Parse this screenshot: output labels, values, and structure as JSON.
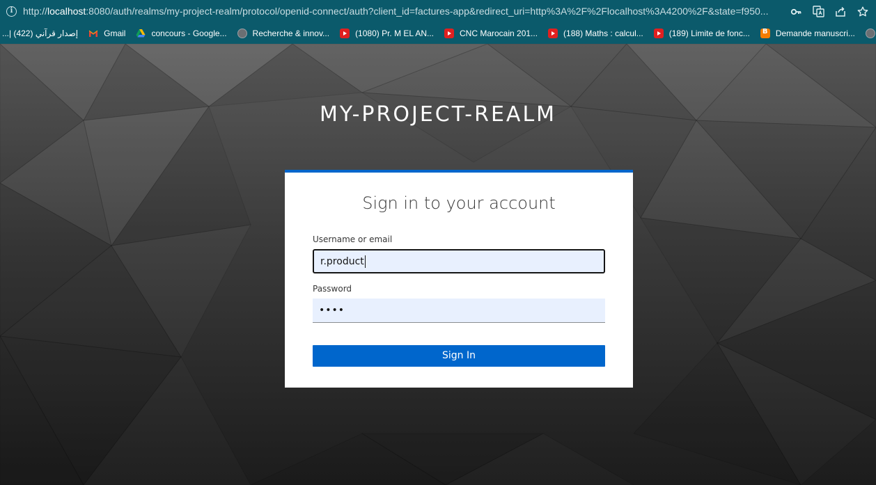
{
  "browser": {
    "url_prefix": "http://",
    "url_host": "localhost",
    "url_rest": ":8080/auth/realms/my-project-realm/protocol/openid-connect/auth?client_id=factures-app&redirect_uri=http%3A%2F%2Flocalhost%3A4200%2F&state=f950...",
    "info_icon_glyph": "i",
    "actions": [
      "key-icon",
      "translate-icon",
      "share-icon",
      "star-icon"
    ]
  },
  "bookmarks": [
    {
      "label": "إصدار قرآني (422) |...",
      "icon": "none"
    },
    {
      "label": "Gmail",
      "icon": "gmail-icon"
    },
    {
      "label": "concours - Google...",
      "icon": "google-drive-icon"
    },
    {
      "label": "Recherche & innov...",
      "icon": "globe-icon"
    },
    {
      "label": "(1080) Pr. M EL AN...",
      "icon": "youtube-icon"
    },
    {
      "label": "CNC Marocain 201...",
      "icon": "youtube-icon"
    },
    {
      "label": "(188) Maths : calcul...",
      "icon": "youtube-icon"
    },
    {
      "label": "(189) Limite de fonc...",
      "icon": "youtube-icon"
    },
    {
      "label": "Demande manuscri...",
      "icon": "blogger-icon"
    }
  ],
  "realm": {
    "title": "MY-PROJECT-REALM"
  },
  "login": {
    "heading": "Sign in to your account",
    "username_label": "Username or email",
    "username_value": "r.product",
    "password_label": "Password",
    "password_value": "••••",
    "submit_label": "Sign In"
  },
  "colors": {
    "browser_chrome": "#0b5a6b",
    "accent": "#0066cc",
    "input_bg": "#e8f0fe"
  }
}
